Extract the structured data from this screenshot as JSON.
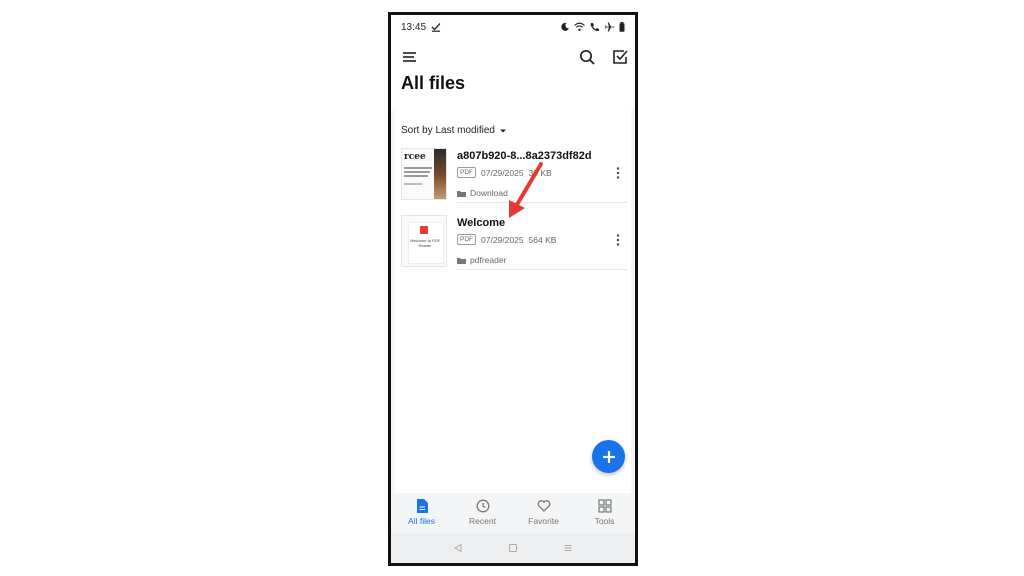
{
  "status": {
    "time": "13:45"
  },
  "header": {
    "title": "All files"
  },
  "sort": {
    "label": "Sort by Last modified"
  },
  "files": [
    {
      "name": "a807b920-8...8a2373df82d",
      "type": "PDF",
      "date": "07/29/2025",
      "size": "30 KB",
      "folder": "Download"
    },
    {
      "name": "Welcome",
      "type": "PDF",
      "date": "07/29/2025",
      "size": "564 KB",
      "folder": "pdfreader"
    }
  ],
  "thumb_text": {
    "t1": "rcee",
    "t2": "Welcome to PDF Reader"
  },
  "bottom_nav": {
    "items": [
      {
        "label": "All files",
        "icon": "file-icon",
        "active": true
      },
      {
        "label": "Recent",
        "icon": "clock-icon",
        "active": false
      },
      {
        "label": "Favorite",
        "icon": "heart-icon",
        "active": false
      },
      {
        "label": "Tools",
        "icon": "grid-icon",
        "active": false
      }
    ]
  },
  "colors": {
    "accent": "#1a73e8",
    "arrow": "#e53935"
  }
}
